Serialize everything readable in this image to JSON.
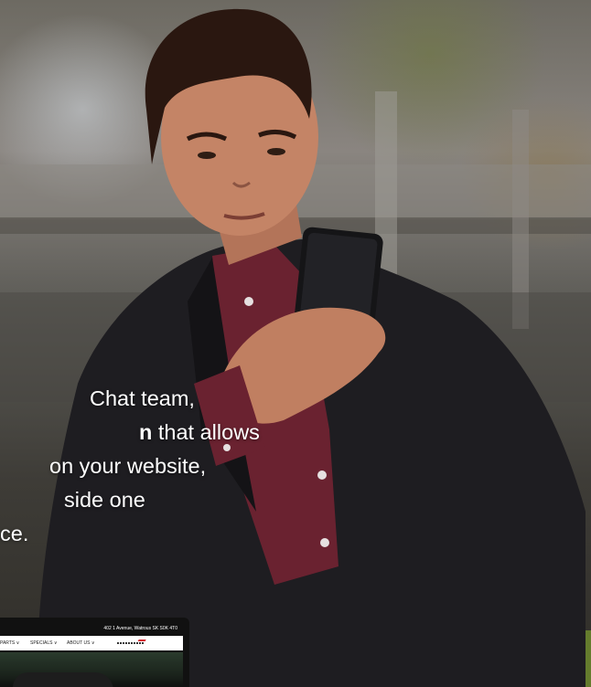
{
  "overlay_text": {
    "line1": "Chat team,",
    "line2_bold": "n",
    "line2_rest": " that allows",
    "line3": "on your website,",
    "line4": "side one",
    "line5": "ce."
  },
  "mockup": {
    "address": "402 1 Avenue, Watrous SK S0K 4T0",
    "nav": [
      "PARTS ∨",
      "SPECIALS ∨",
      "ABOUT US ∨"
    ]
  },
  "colors": {
    "text": "#ffffff",
    "brand_red": "#d6212e",
    "shirt": "#6d2330",
    "jacket": "#1c1b1e"
  }
}
